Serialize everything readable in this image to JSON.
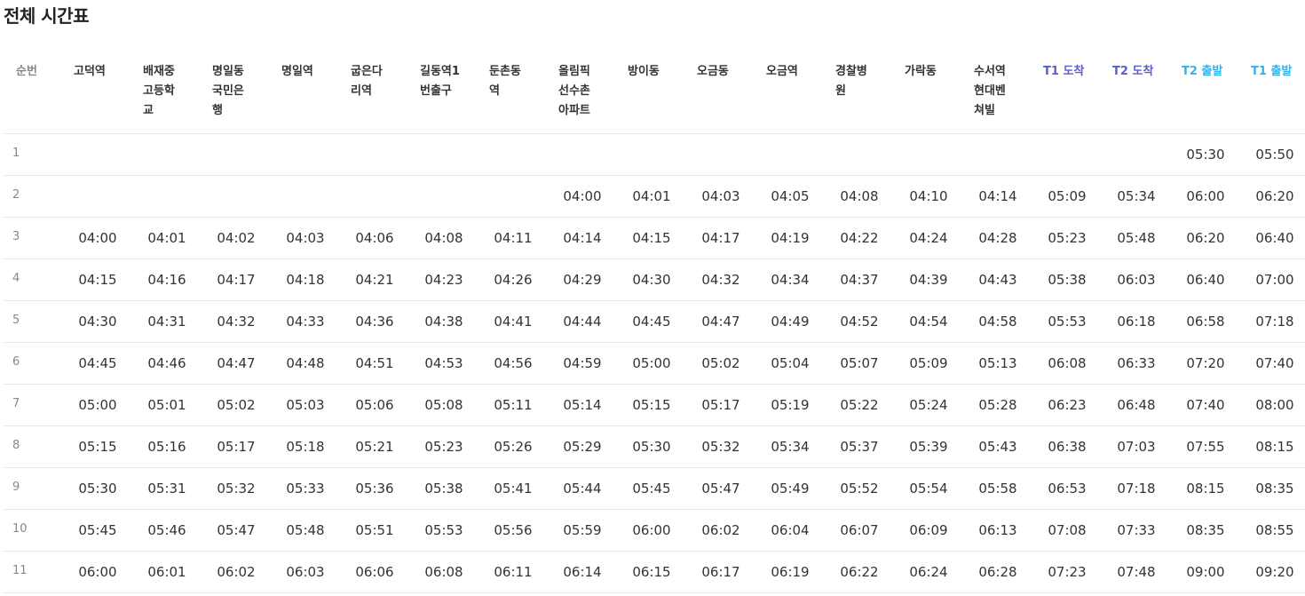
{
  "page": {
    "title": "전체 시간표"
  },
  "table": {
    "seq_header": "순번",
    "stops": [
      {
        "name": "고덕역",
        "kind": "stop"
      },
      {
        "name": "배재중고등학교",
        "kind": "stop"
      },
      {
        "name": "명일동국민은행",
        "kind": "stop"
      },
      {
        "name": "명일역",
        "kind": "stop"
      },
      {
        "name": "굽은다리역",
        "kind": "stop"
      },
      {
        "name": "길동역1번출구",
        "kind": "stop"
      },
      {
        "name": "둔촌동역",
        "kind": "stop"
      },
      {
        "name": "올림픽선수촌아파트",
        "kind": "stop"
      },
      {
        "name": "방이동",
        "kind": "stop"
      },
      {
        "name": "오금동",
        "kind": "stop"
      },
      {
        "name": "오금역",
        "kind": "stop"
      },
      {
        "name": "경찰병원",
        "kind": "stop"
      },
      {
        "name": "가락동",
        "kind": "stop"
      },
      {
        "name": "수서역현대벤쳐빌",
        "kind": "stop"
      },
      {
        "name": "T1 도착",
        "kind": "arrive"
      },
      {
        "name": "T2 도착",
        "kind": "arrive"
      },
      {
        "name": "T2 출발",
        "kind": "depart"
      },
      {
        "name": "T1 출발",
        "kind": "depart"
      }
    ],
    "rows": [
      {
        "seq": "1",
        "times": [
          "",
          "",
          "",
          "",
          "",
          "",
          "",
          "",
          "",
          "",
          "",
          "",
          "",
          "",
          "",
          "",
          "05:30",
          "05:50"
        ]
      },
      {
        "seq": "2",
        "times": [
          "",
          "",
          "",
          "",
          "",
          "",
          "",
          "04:00",
          "04:01",
          "04:03",
          "04:05",
          "04:08",
          "04:10",
          "04:14",
          "05:09",
          "05:34",
          "06:00",
          "06:20"
        ]
      },
      {
        "seq": "3",
        "times": [
          "04:00",
          "04:01",
          "04:02",
          "04:03",
          "04:06",
          "04:08",
          "04:11",
          "04:14",
          "04:15",
          "04:17",
          "04:19",
          "04:22",
          "04:24",
          "04:28",
          "05:23",
          "05:48",
          "06:20",
          "06:40"
        ]
      },
      {
        "seq": "4",
        "times": [
          "04:15",
          "04:16",
          "04:17",
          "04:18",
          "04:21",
          "04:23",
          "04:26",
          "04:29",
          "04:30",
          "04:32",
          "04:34",
          "04:37",
          "04:39",
          "04:43",
          "05:38",
          "06:03",
          "06:40",
          "07:00"
        ]
      },
      {
        "seq": "5",
        "times": [
          "04:30",
          "04:31",
          "04:32",
          "04:33",
          "04:36",
          "04:38",
          "04:41",
          "04:44",
          "04:45",
          "04:47",
          "04:49",
          "04:52",
          "04:54",
          "04:58",
          "05:53",
          "06:18",
          "06:58",
          "07:18"
        ]
      },
      {
        "seq": "6",
        "times": [
          "04:45",
          "04:46",
          "04:47",
          "04:48",
          "04:51",
          "04:53",
          "04:56",
          "04:59",
          "05:00",
          "05:02",
          "05:04",
          "05:07",
          "05:09",
          "05:13",
          "06:08",
          "06:33",
          "07:20",
          "07:40"
        ]
      },
      {
        "seq": "7",
        "times": [
          "05:00",
          "05:01",
          "05:02",
          "05:03",
          "05:06",
          "05:08",
          "05:11",
          "05:14",
          "05:15",
          "05:17",
          "05:19",
          "05:22",
          "05:24",
          "05:28",
          "06:23",
          "06:48",
          "07:40",
          "08:00"
        ]
      },
      {
        "seq": "8",
        "times": [
          "05:15",
          "05:16",
          "05:17",
          "05:18",
          "05:21",
          "05:23",
          "05:26",
          "05:29",
          "05:30",
          "05:32",
          "05:34",
          "05:37",
          "05:39",
          "05:43",
          "06:38",
          "07:03",
          "07:55",
          "08:15"
        ]
      },
      {
        "seq": "9",
        "times": [
          "05:30",
          "05:31",
          "05:32",
          "05:33",
          "05:36",
          "05:38",
          "05:41",
          "05:44",
          "05:45",
          "05:47",
          "05:49",
          "05:52",
          "05:54",
          "05:58",
          "06:53",
          "07:18",
          "08:15",
          "08:35"
        ]
      },
      {
        "seq": "10",
        "times": [
          "05:45",
          "05:46",
          "05:47",
          "05:48",
          "05:51",
          "05:53",
          "05:56",
          "05:59",
          "06:00",
          "06:02",
          "06:04",
          "06:07",
          "06:09",
          "06:13",
          "07:08",
          "07:33",
          "08:35",
          "08:55"
        ]
      },
      {
        "seq": "11",
        "times": [
          "06:00",
          "06:01",
          "06:02",
          "06:03",
          "06:06",
          "06:08",
          "06:11",
          "06:14",
          "06:15",
          "06:17",
          "06:19",
          "06:22",
          "06:24",
          "06:28",
          "07:23",
          "07:48",
          "09:00",
          "09:20"
        ]
      }
    ]
  },
  "colors": {
    "text": "#333333",
    "muted": "#888888",
    "arrive_header": "#5a5fc8",
    "depart_header": "#35b3e6",
    "row_divider": "#e6e6e6"
  }
}
